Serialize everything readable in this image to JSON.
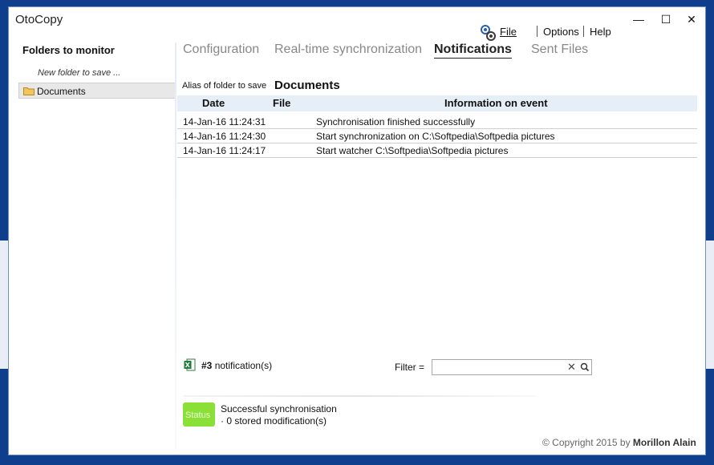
{
  "window": {
    "title": "OtoCopy",
    "controls": {
      "minimize": "—",
      "maximize": "☐",
      "close": "✕"
    }
  },
  "menu": {
    "file": "File",
    "options": "Options",
    "help": "Help"
  },
  "sidebar": {
    "title": "Folders to monitor",
    "new_folder": "New folder to save ...",
    "folders": [
      {
        "label": "Documents",
        "icon": "folder-icon"
      }
    ]
  },
  "tabs": [
    {
      "label": "Configuration",
      "active": false
    },
    {
      "label": "Real-time synchronization",
      "active": false
    },
    {
      "label": "Notifications",
      "active": true
    },
    {
      "label": "Sent Files",
      "active": false
    }
  ],
  "alias": {
    "label": "Alias of folder to save",
    "value": "Documents"
  },
  "table": {
    "columns": [
      "Date",
      "File",
      "Information on event"
    ],
    "rows": [
      {
        "date": "14-Jan-16 11:24:31",
        "file": "",
        "info": "Synchronisation finished successfully"
      },
      {
        "date": "14-Jan-16 11:24:30",
        "file": "",
        "info": "Start synchronization on C:\\Softpedia\\Softpedia pictures"
      },
      {
        "date": "14-Jan-16 11:24:17",
        "file": "",
        "info": "Start watcher C:\\Softpedia\\Softpedia pictures"
      }
    ]
  },
  "footer": {
    "count_number": "#3",
    "count_suffix": "notification(s)",
    "filter_label": "Filter  =",
    "filter_value": "",
    "status_badge": "Status",
    "status_line1": "Successful synchronisation",
    "status_line2": "· 0 stored modification(s)",
    "copyright_prefix": "© Copyright 2015 by",
    "copyright_author": "Morillon Alain"
  },
  "colors": {
    "frame": "#0f3f8c",
    "status_green": "#8be038",
    "header_bg": "#e6eef8"
  }
}
